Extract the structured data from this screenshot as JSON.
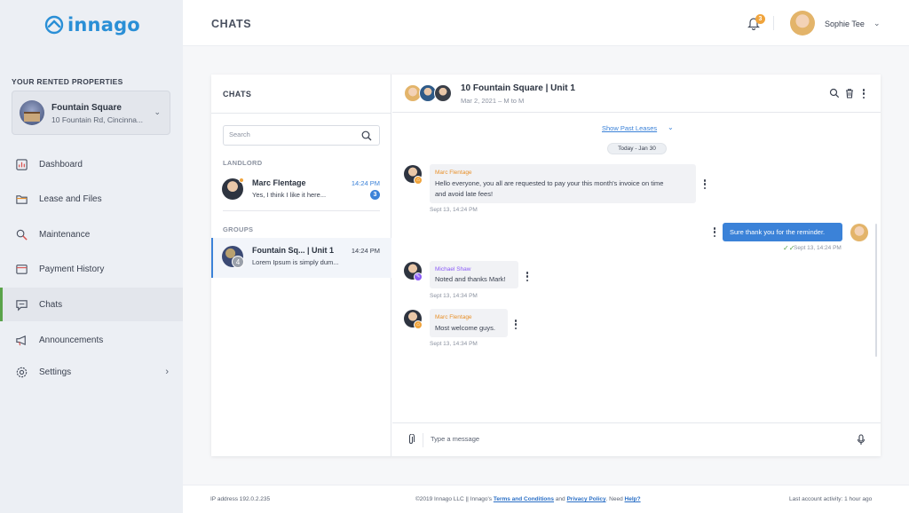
{
  "app": {
    "logo_text": "innago"
  },
  "sidebar": {
    "properties_title": "YOUR RENTED PROPERTIES",
    "property": {
      "name": "Fountain Square",
      "address": "10 Fountain Rd, Cincinna..."
    },
    "items": [
      {
        "label": "Dashboard",
        "icon": "dashboard-icon"
      },
      {
        "label": "Lease and Files",
        "icon": "folder-icon"
      },
      {
        "label": "Maintenance",
        "icon": "wrench-icon"
      },
      {
        "label": "Payment History",
        "icon": "payment-icon"
      },
      {
        "label": "Chats",
        "icon": "chat-icon",
        "active": true
      },
      {
        "label": "Announcements",
        "icon": "megaphone-icon"
      },
      {
        "label": "Settings",
        "icon": "gear-icon"
      }
    ]
  },
  "header": {
    "title": "CHATS",
    "notification_count": "3",
    "user_name": "Sophie Tee"
  },
  "chat_list": {
    "title": "CHATS",
    "search_placeholder": "Search",
    "landlord_label": "LANDLORD",
    "groups_label": "GROUPS",
    "landlord": {
      "name": "Marc Flentage",
      "time": "14:24 PM",
      "snippet": "Yes, I think I like it here...",
      "unread": "3"
    },
    "group": {
      "name": "Fountain Sq... | Unit 1",
      "time": "14:24 PM",
      "snippet": "Lorem Ipsum is simply dum...",
      "members": "4"
    }
  },
  "conversation": {
    "title": "10 Fountain Square | Unit 1",
    "subtitle": "Mar 2, 2021 – M to M",
    "past_leases": "Show Past Leases",
    "day_label": "Today - Jan 30",
    "messages": [
      {
        "sender": "Marc Flentage",
        "line1": "Hello everyone, you all are requested to pay your this month's invoice on time",
        "line2": "and avoid late fees!",
        "time": "Sept 13, 14:24 PM"
      },
      {
        "text": "Sure thank you for the reminder.",
        "time": "Sept 13, 14:24 PM"
      },
      {
        "sender": "Michael Shaw",
        "line1": "Noted and thanks Mark!",
        "time": "Sept 13, 14:34 PM"
      },
      {
        "sender": "Marc Flentage",
        "line1": "Most welcome guys.",
        "time": "Sept 13, 14:34 PM"
      }
    ],
    "composer_placeholder": "Type a message"
  },
  "footer": {
    "ip": "IP address 192.0.2.235",
    "copyright": "©2019 Innago LLC || Innago's",
    "terms": "Terms and Conditions",
    "and": "and",
    "privacy": "Privacy Policy",
    "need": ". Need",
    "help": "Help?",
    "activity": "Last account activity: 1 hour ago"
  },
  "colors": {
    "accent": "#3b82d8",
    "brand": "#2a8fd6",
    "active_bar": "#5aa34a",
    "badge": "#f0a43c"
  }
}
